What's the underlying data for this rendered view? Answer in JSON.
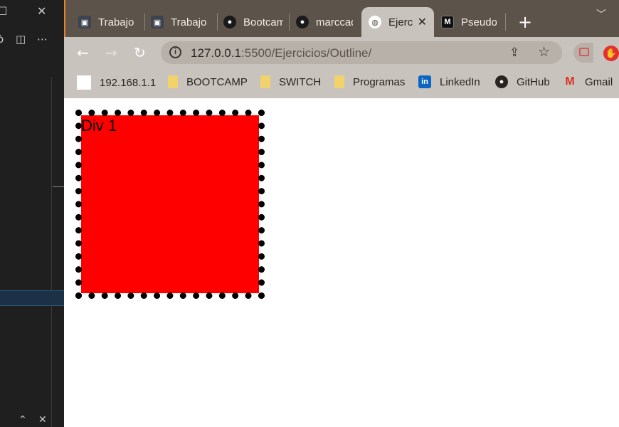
{
  "browser": {
    "tabs": [
      {
        "title": "Trabajo",
        "favicon": "classroom-icon",
        "active": false
      },
      {
        "title": "Trabajo",
        "favicon": "classroom-icon",
        "active": false
      },
      {
        "title": "Bootcamp",
        "favicon": "github-icon",
        "active": false
      },
      {
        "title": "marccad",
        "favicon": "github-icon",
        "active": false
      },
      {
        "title": "Ejercicios",
        "favicon": "globe-icon",
        "active": true
      },
      {
        "title": "Pseudo",
        "favicon": "mdn-icon",
        "active": false
      }
    ],
    "new_tab_label": "+",
    "address": {
      "host": "127.0.0.1",
      "rest": ":5500/Ejercicios/Outline/"
    },
    "bookmarks": [
      {
        "label": "192.168.1.1",
        "icon": "blank-page-icon"
      },
      {
        "label": "BOOTCAMP",
        "icon": "folder-icon"
      },
      {
        "label": "SWITCH",
        "icon": "folder-icon"
      },
      {
        "label": "Programas",
        "icon": "folder-icon"
      },
      {
        "label": "LinkedIn",
        "icon": "linkedin-icon"
      },
      {
        "label": "GitHub",
        "icon": "github-icon"
      },
      {
        "label": "Gmail",
        "icon": "gmail-icon"
      }
    ]
  },
  "page": {
    "div1_label": "Div 1",
    "colors": {
      "box_fill": "#ff0000",
      "outline": "#000000",
      "tab_active": "#c9c3bd",
      "tabstrip": "#5c534b"
    }
  }
}
